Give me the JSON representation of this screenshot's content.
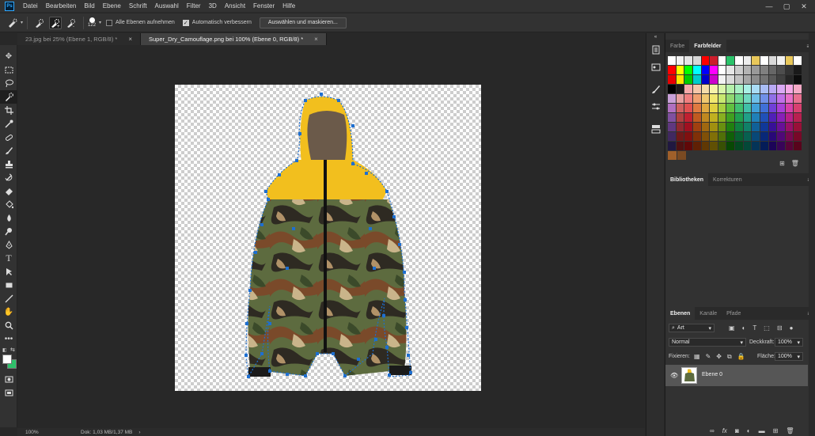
{
  "app": {
    "logo": "Ps"
  },
  "menu": [
    "Datei",
    "Bearbeiten",
    "Bild",
    "Ebene",
    "Schrift",
    "Auswahl",
    "Filter",
    "3D",
    "Ansicht",
    "Fenster",
    "Hilfe"
  ],
  "options": {
    "brush_size": "122",
    "all_layers_label": "Alle Ebenen aufnehmen",
    "all_layers_checked": false,
    "auto_enhance_label": "Automatisch verbessern",
    "auto_enhance_checked": true,
    "select_mask_label": "Auswählen und maskieren..."
  },
  "tabs": [
    {
      "label": "23.jpg bei 25% (Ebene 1, RGB/8) *",
      "close": "×",
      "active": false
    },
    {
      "label": "Super_Dry_Camouflage.png bei 100% (Ebene 0, RGB/8) *",
      "close": "×",
      "active": true
    }
  ],
  "status": {
    "zoom": "100%",
    "doc": "Dok: 1,03 MB/1,37 MB",
    "arrow": "›"
  },
  "panels": {
    "color_tabs": [
      "Farbe",
      "Farbfelder"
    ],
    "library_tabs": [
      "Bibliotheken",
      "Korrekturen"
    ],
    "layer_tabs": [
      "Ebenen",
      "Kanäle",
      "Pfade"
    ],
    "filter_kind": "Art",
    "blend_mode": "Normal",
    "opacity_label": "Deckkraft:",
    "opacity": "100%",
    "lock_label": "Fixieren:",
    "fill_label": "Fläche:",
    "fill": "100%",
    "layer_name": "Ebene 0",
    "layer_bottom_icons": [
      "link-icon",
      "fx-icon",
      "mask-icon",
      "adjustment-icon",
      "folder-icon",
      "new-layer-icon",
      "trash-icon"
    ]
  },
  "colors": {
    "accent_selection": "#1e6fd0",
    "fg": "#ffffff",
    "bg": "#2ec06a"
  },
  "swatch_rows": [
    [
      "#ffffff",
      "#f2f2f2",
      "#e5e5e5",
      "#d7d7d7",
      "#ff0000",
      "#cc1d2c",
      "#ffffff",
      "#2bc36a",
      "#ffffff",
      "#ededed",
      "#e8c75a",
      "#ffffff",
      "#d9d9d9",
      "#f1f1f1",
      "#e8c75a",
      "#ffffff"
    ],
    [
      "#ff0000",
      "#ffff00",
      "#00ff00",
      "#00ffff",
      "#0000ff",
      "#ff00ff",
      "#ffffff",
      "#e6e6e6",
      "#cccccc",
      "#b3b3b3",
      "#999999",
      "#808080",
      "#666666",
      "#4d4d4d",
      "#333333",
      "#1a1a1a"
    ],
    [
      "#e60000",
      "#ffe600",
      "#00cc00",
      "#00cccc",
      "#0000cc",
      "#cc00cc",
      "#f2f2f2",
      "#dadada",
      "#c0c0c0",
      "#a6a6a6",
      "#8c8c8c",
      "#737373",
      "#595959",
      "#404040",
      "#262626",
      "#0d0d0d"
    ],
    [
      "#000000",
      "#1a1a1a",
      "#f5a9a9",
      "#f5c6a9",
      "#f5dca9",
      "#f5f3a9",
      "#d9f5a9",
      "#b4f0a9",
      "#a9f0c4",
      "#a9f0e6",
      "#a9dcf5",
      "#a9bdf5",
      "#b9a9f5",
      "#d9a9f5",
      "#f5a9e6",
      "#f5a9c6"
    ],
    [
      "#c8a0d8",
      "#e8a0a0",
      "#f08080",
      "#f0a070",
      "#f0c870",
      "#f0e870",
      "#c8e870",
      "#90d870",
      "#70d890",
      "#70d8c0",
      "#70c0e8",
      "#7090e8",
      "#9070e8",
      "#c070e8",
      "#e870c8",
      "#e87090"
    ],
    [
      "#b070c0",
      "#d06060",
      "#e05050",
      "#e07a40",
      "#e0a840",
      "#e0d040",
      "#a8d040",
      "#60c040",
      "#40c070",
      "#40c0a8",
      "#40a0d8",
      "#4070d8",
      "#7040d8",
      "#a840d8",
      "#d840a8",
      "#d84070"
    ],
    [
      "#8050a0",
      "#b04040",
      "#c02030",
      "#c05a20",
      "#c08820",
      "#c0b020",
      "#88b020",
      "#40a020",
      "#20a050",
      "#20a088",
      "#2080b8",
      "#2050b8",
      "#5020b8",
      "#8820b8",
      "#b82088",
      "#b82050"
    ],
    [
      "#603880",
      "#902830",
      "#a01020",
      "#a04010",
      "#a06810",
      "#a09010",
      "#689010",
      "#208010",
      "#108040",
      "#108068",
      "#106098",
      "#103898",
      "#381098",
      "#681098",
      "#981068",
      "#981038"
    ],
    [
      "#402860",
      "#701818",
      "#801010",
      "#803008",
      "#805008",
      "#807008",
      "#507008",
      "#106008",
      "#086030",
      "#086050",
      "#084878",
      "#082878",
      "#280878",
      "#500878",
      "#780850",
      "#780828"
    ],
    [
      "#201840",
      "#501010",
      "#600808",
      "#602004",
      "#603804",
      "#605004",
      "#385004",
      "#084804",
      "#044820",
      "#044838",
      "#043458",
      "#041c58",
      "#1c0458",
      "#380458",
      "#580438",
      "#58041c"
    ],
    [
      "#a0602a",
      "#7a4a22"
    ]
  ]
}
